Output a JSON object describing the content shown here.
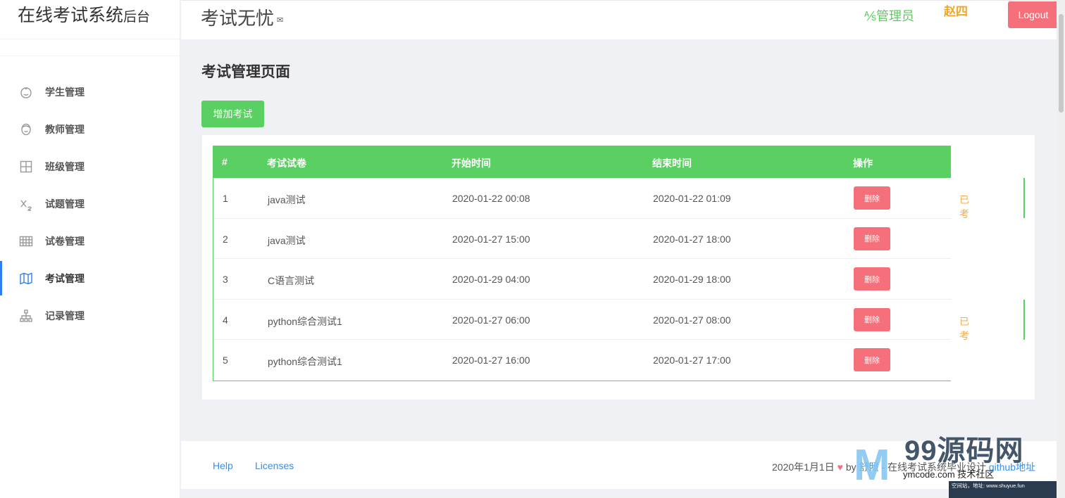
{
  "sidebar": {
    "brand_main": "在线考试系统",
    "brand_sub": "后台",
    "items": [
      {
        "label": "学生管理",
        "icon": "smile-icon"
      },
      {
        "label": "教师管理",
        "icon": "face-icon"
      },
      {
        "label": "班级管理",
        "icon": "grid-icon"
      },
      {
        "label": "试题管理",
        "icon": "subscript-icon"
      },
      {
        "label": "试卷管理",
        "icon": "table-icon"
      },
      {
        "label": "考试管理",
        "icon": "map-icon",
        "active": true
      },
      {
        "label": "记录管理",
        "icon": "sitemap-icon"
      }
    ]
  },
  "header": {
    "title": "考试无忧",
    "title_mini": "✉",
    "role": "⅍管理员",
    "user": "赵四",
    "logout": "Logout"
  },
  "main": {
    "page_title": "考试管理页面",
    "add_button": "增加考试",
    "columns": [
      "#",
      "考试试卷",
      "开始时间",
      "结束时间",
      "操作"
    ],
    "rows": [
      {
        "id": "1",
        "paper": "java测试",
        "start": "2020-01-22 00:08",
        "end": "2020-01-22 01:09",
        "action": "删除",
        "status": "已考"
      },
      {
        "id": "2",
        "paper": "java测试",
        "start": "2020-01-27 15:00",
        "end": "2020-01-27 18:00",
        "action": "删除",
        "status": ""
      },
      {
        "id": "3",
        "paper": "C语言测试",
        "start": "2020-01-29 04:00",
        "end": "2020-01-29 18:00",
        "action": "删除",
        "status": ""
      },
      {
        "id": "4",
        "paper": "python综合测试1",
        "start": "2020-01-27 06:00",
        "end": "2020-01-27 08:00",
        "action": "删除",
        "status": "已考"
      },
      {
        "id": "5",
        "paper": "python综合测试1",
        "start": "2020-01-27 16:00",
        "end": "2020-01-27 17:00",
        "action": "删除",
        "status": ""
      }
    ]
  },
  "footer": {
    "help": "Help",
    "licenses": "Licenses",
    "date": "2020年1月1日",
    "by": "by",
    "author": "舒照",
    "desc": " - 在线考试系统毕业设计 ",
    "github": "github地址"
  },
  "watermark": {
    "brand": "99源码网",
    "sub": "ymcode.com 技术社区",
    "strip": "空间站，地址: www.shuyue.fun"
  },
  "colors": {
    "accent_green": "#5bd062",
    "danger": "#f5707a",
    "warning": "#f0ad4e",
    "link": "#3a8ee6",
    "active_nav": "#2f7ef5"
  }
}
